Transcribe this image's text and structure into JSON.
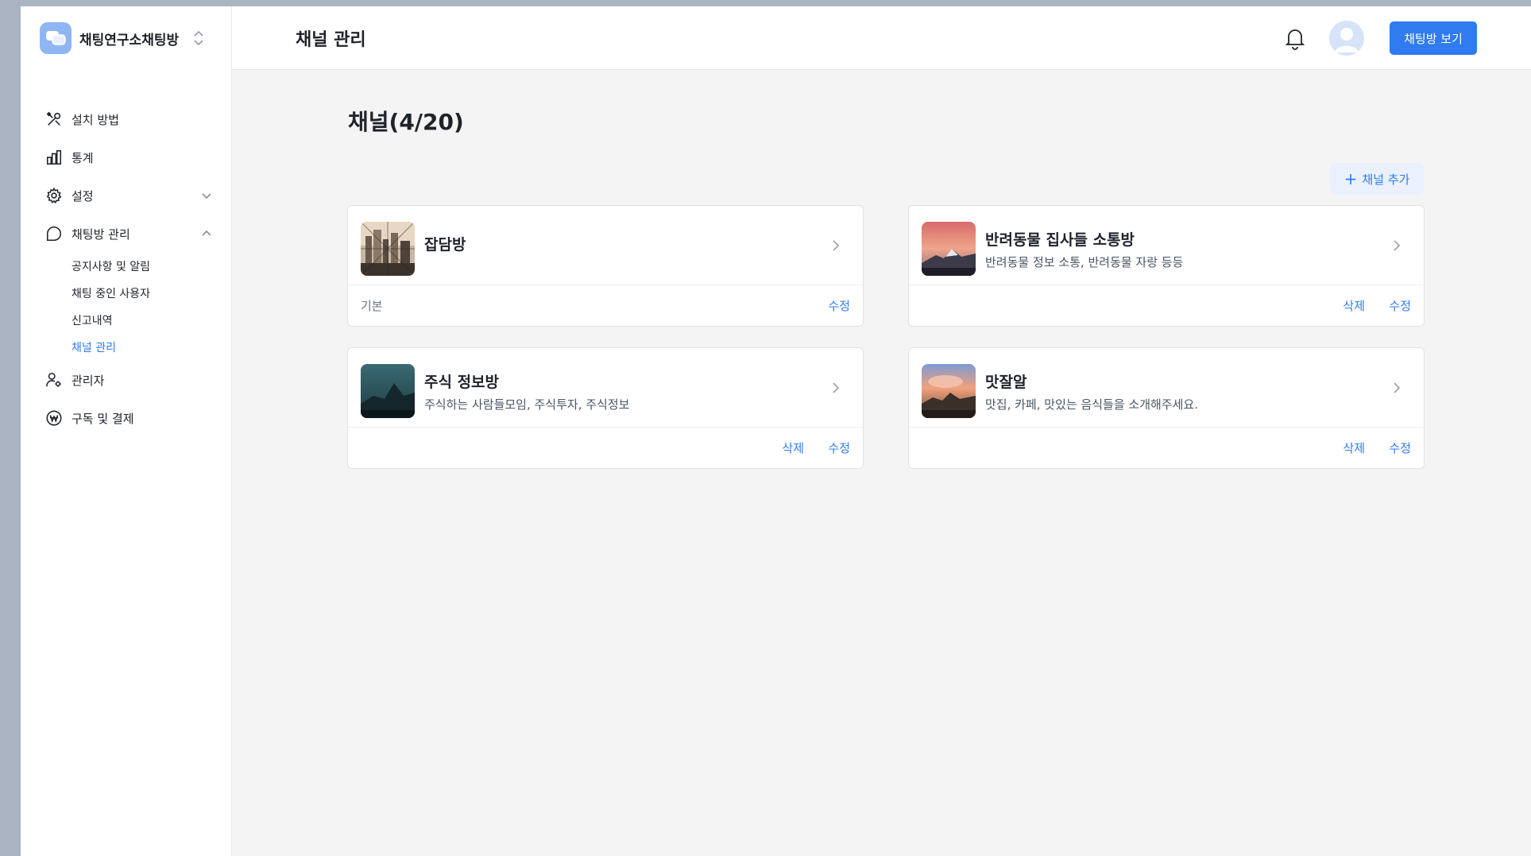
{
  "workspace": {
    "name": "채팅연구소채팅방"
  },
  "sidebar": {
    "items": [
      {
        "label": "설치 방법"
      },
      {
        "label": "통계"
      },
      {
        "label": "설정"
      },
      {
        "label": "채팅방 관리"
      },
      {
        "label": "관리자"
      },
      {
        "label": "구독 및 결제"
      }
    ],
    "chat_submenu": [
      {
        "label": "공지사항 및 알림"
      },
      {
        "label": "채팅 중인 사용자"
      },
      {
        "label": "신고내역"
      },
      {
        "label": "채널 관리"
      }
    ]
  },
  "header": {
    "title": "채널 관리",
    "view_button": "채팅방 보기"
  },
  "main": {
    "heading": "채널(4/20)",
    "add_button": "채널 추가",
    "channels": [
      {
        "name": "잡담방",
        "description": "",
        "badge": "기본",
        "delete_label": "",
        "edit_label": "수정"
      },
      {
        "name": "반려동물 집사들 소통방",
        "description": "반려동물 정보 소통, 반려동물 자랑 등등",
        "badge": "",
        "delete_label": "삭제",
        "edit_label": "수정"
      },
      {
        "name": "주식 정보방",
        "description": "주식하는 사람들모임, 주식투자, 주식정보",
        "badge": "",
        "delete_label": "삭제",
        "edit_label": "수정"
      },
      {
        "name": "맛잘알",
        "description": "맛집, 카페, 맛있는 음식들을 소개해주세요.",
        "badge": "",
        "delete_label": "삭제",
        "edit_label": "수정"
      }
    ]
  },
  "colors": {
    "accent": "#2f7bef",
    "sidebar_bg": "#ffffff",
    "content_bg": "#f4f4f5"
  },
  "icons": [
    "chat-bubble-icon",
    "updown-chevron-icon",
    "tools-icon",
    "bar-chart-icon",
    "gear-icon",
    "chat-icon",
    "admin-icon",
    "won-icon",
    "bell-icon",
    "chevron-right-icon"
  ]
}
